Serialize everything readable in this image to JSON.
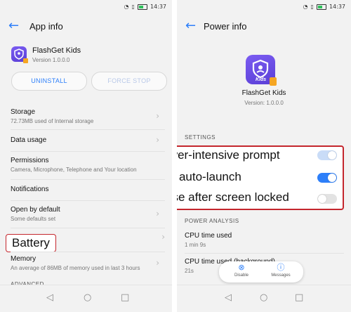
{
  "status": {
    "time": "14:37"
  },
  "app_info": {
    "title": "App info",
    "app_name": "FlashGet Kids",
    "version": "Version 1.0.0.0",
    "uninstall_label": "UNINSTALL",
    "force_stop_label": "FORCE STOP",
    "rows": [
      {
        "title": "Storage",
        "sub": "72.73MB used of Internal storage"
      },
      {
        "title": "Data usage",
        "sub": ""
      },
      {
        "title": "Permissions",
        "sub": "Camera, Microphone, Telephone and Your location"
      },
      {
        "title": "Notifications",
        "sub": ""
      },
      {
        "title": "Open by default",
        "sub": "Some defaults set"
      },
      {
        "title": "Memory",
        "sub": "An average of 86MB of memory used in last 3 hours"
      }
    ],
    "advanced_label": "ADVANCED",
    "battery_callout": "Battery"
  },
  "power_info": {
    "title": "Power info",
    "app_name": "FlashGet Kids",
    "version": "Version: 1.0.0.0",
    "settings_label": "SETTINGS",
    "power_analysis_label": "POWER ANALYSIS",
    "toggles": [
      {
        "label": "Power-intensive prompt",
        "state": "on-disabled"
      },
      {
        "label": "App auto-launch",
        "state": "on"
      },
      {
        "label": "Close after screen locked",
        "state": "off"
      }
    ],
    "cpu_used": {
      "title": "CPU time used",
      "value": "1 min 9s"
    },
    "cpu_background": {
      "title": "CPU time used (background)",
      "value": "21s"
    },
    "float_actions": {
      "disable": "Disable",
      "messages": "Messages"
    }
  },
  "icons": {
    "kids_badge": "Kids"
  },
  "colors": {
    "accent": "#2d7ff9",
    "callout_border": "#c4262d",
    "app_purple": "#6b4fe6",
    "badge_orange": "#f5a623"
  }
}
